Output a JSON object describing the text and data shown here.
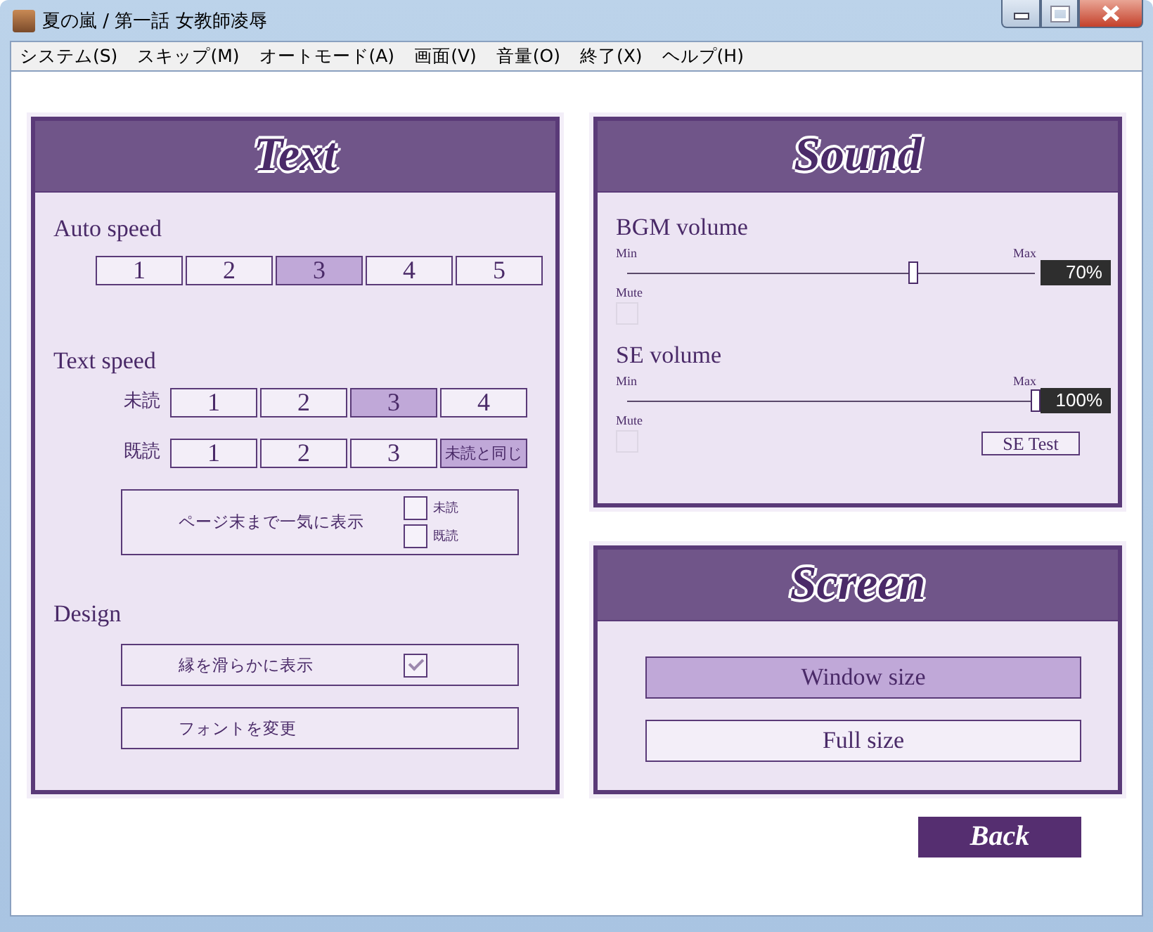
{
  "window": {
    "title": "夏の嵐 / 第一話 女教師凌辱"
  },
  "menu": [
    "システム(S)",
    "スキップ(M)",
    "オートモード(A)",
    "画面(V)",
    "音量(O)",
    "終了(X)",
    "ヘルプ(H)"
  ],
  "text_panel": {
    "title": "Text",
    "auto_speed": {
      "label": "Auto speed",
      "options": [
        {
          "label": "1",
          "selected": false
        },
        {
          "label": "2",
          "selected": false
        },
        {
          "label": "3",
          "selected": true
        },
        {
          "label": "4",
          "selected": false
        },
        {
          "label": "5",
          "selected": false
        }
      ]
    },
    "text_speed": {
      "label": "Text speed",
      "rows": [
        {
          "label": "未読",
          "options": [
            {
              "label": "1",
              "selected": false
            },
            {
              "label": "2",
              "selected": false
            },
            {
              "label": "3",
              "selected": true
            },
            {
              "label": "4",
              "selected": false
            }
          ]
        },
        {
          "label": "既読",
          "options": [
            {
              "label": "1",
              "selected": false
            },
            {
              "label": "2",
              "selected": false
            },
            {
              "label": "3",
              "selected": false
            },
            {
              "label": "未読と同じ",
              "selected": true
            }
          ]
        }
      ]
    },
    "page_end": {
      "label": "ページ末まで一気に表示",
      "checks": [
        {
          "label": "未読",
          "checked": false
        },
        {
          "label": "既読",
          "checked": false
        }
      ]
    },
    "design": {
      "label": "Design",
      "smooth": {
        "label": "縁を滑らかに表示",
        "checked": true
      },
      "font_button": "フォントを変更"
    }
  },
  "sound_panel": {
    "title": "Sound",
    "volumes": [
      {
        "label": "BGM volume",
        "min": "Min",
        "max": "Max",
        "level": 0.7,
        "reading": "70%",
        "mute_label": "Mute",
        "muted": false
      },
      {
        "label": "SE volume",
        "min": "Min",
        "max": "Max",
        "level": 1.0,
        "reading": "100%",
        "mute_label": "Mute",
        "muted": false
      }
    ],
    "test_button": "SE Test"
  },
  "screen_panel": {
    "title": "Screen",
    "options": [
      {
        "label": "Window size",
        "selected": true
      },
      {
        "label": "Full size",
        "selected": false
      }
    ]
  },
  "back_button": "Back"
}
